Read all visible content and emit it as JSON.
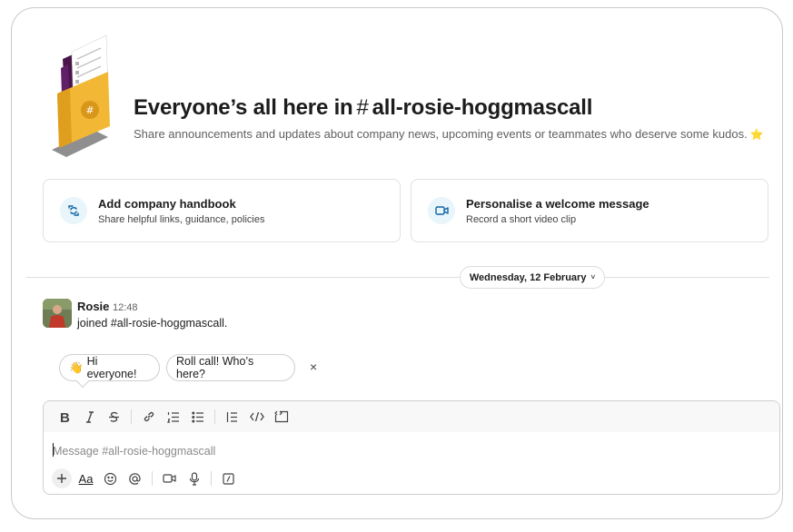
{
  "channel": {
    "title_prefix": "Everyone’s all here in",
    "hash": "#",
    "name": "all-rosie-hoggmascall",
    "description": "Share announcements and updates about company news, upcoming events or teammates who deserve some kudos.",
    "description_emoji": "⭐"
  },
  "cards": [
    {
      "title": "Add company handbook",
      "subtitle": "Share helpful links, guidance, policies",
      "icon": "handbook-icon"
    },
    {
      "title": "Personalise a welcome message",
      "subtitle": "Record a short video clip",
      "icon": "video-icon"
    }
  ],
  "date_divider": {
    "label": "Wednesday, 12 February",
    "chevron": "˅"
  },
  "message": {
    "author": "Rosie",
    "time": "12:48",
    "text": "joined #all-rosie-hoggmascall."
  },
  "suggestions": [
    {
      "emoji": "👋",
      "label": "Hi everyone!"
    },
    {
      "label": "Roll call! Who’s here?"
    }
  ],
  "dismiss_label": "×",
  "composer": {
    "placeholder": "Message #all-rosie-hoggmascall",
    "format_tools": [
      "bold-icon",
      "italic-icon",
      "strikethrough-icon",
      "link-icon",
      "ordered-list-icon",
      "bulleted-list-icon",
      "blockquote-icon",
      "code-icon",
      "code-block-icon"
    ],
    "bottom_tools": [
      "plus-icon",
      "text-format-icon",
      "emoji-icon",
      "mention-icon",
      "video-icon",
      "microphone-icon",
      "slash-command-icon"
    ],
    "aa_label": "Aa"
  },
  "colors": {
    "accent_blue": "#1264a3",
    "folder_yellow": "#f2b835",
    "folder_purple": "#4a154b",
    "card_icon_bg": "#e8f5fa"
  }
}
